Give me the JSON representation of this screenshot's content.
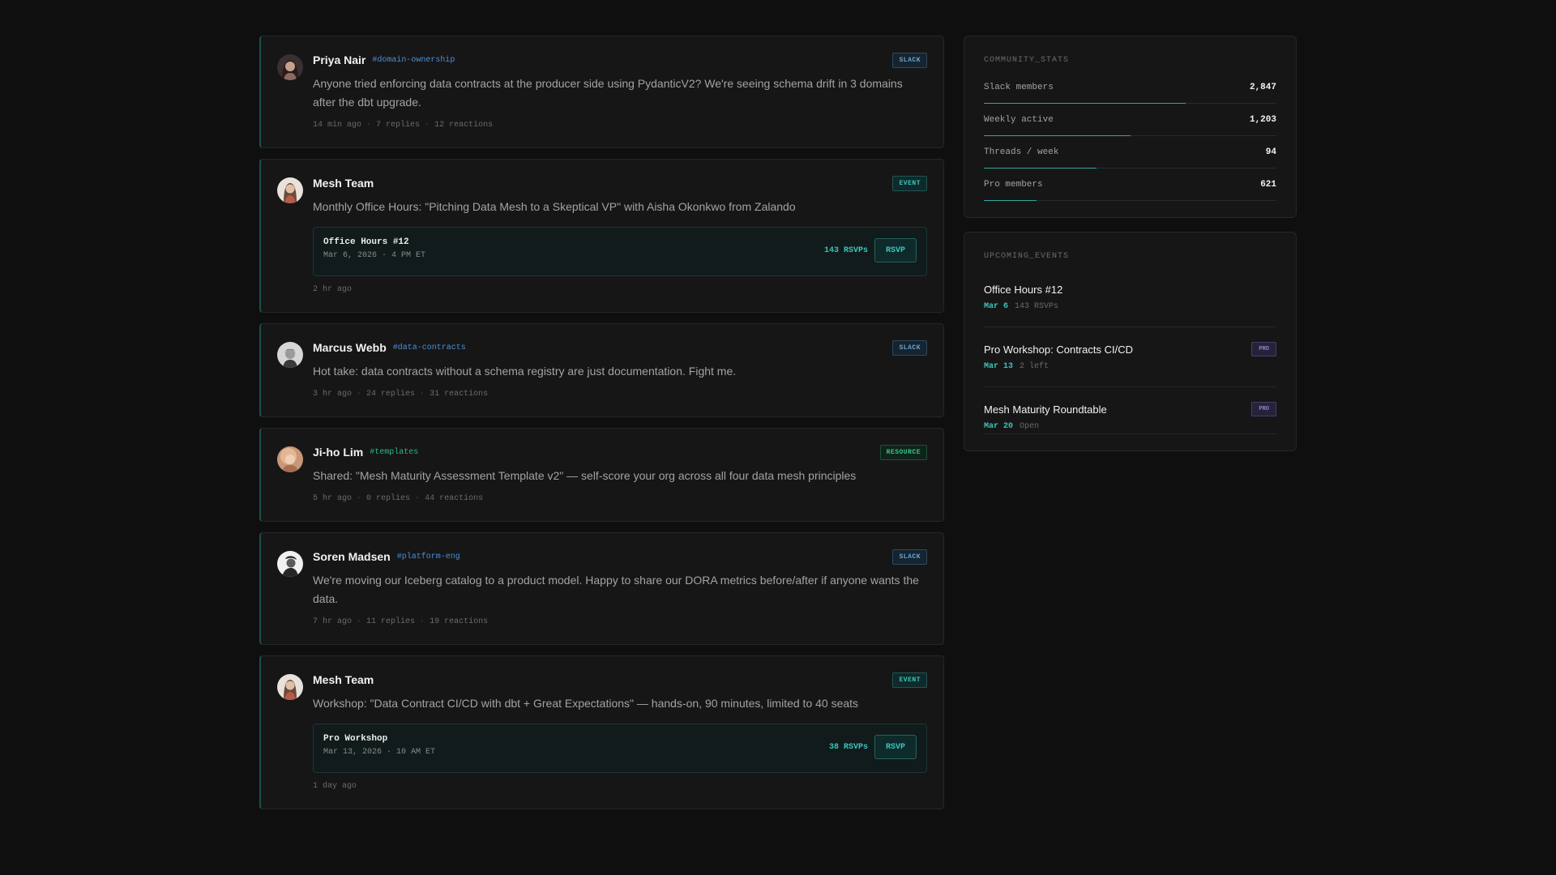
{
  "feed": {
    "posts": [
      {
        "author": "Priya Nair",
        "channel": "#domain-ownership",
        "tag": "SLACK",
        "body": "Anyone tried enforcing data contracts at the producer side using PydanticV2? We're seeing schema drift in 3 domains after the dbt upgrade.",
        "time": "14 min ago",
        "replies": "7 replies",
        "reactions": "12 reactions"
      },
      {
        "author": "Mesh Team",
        "tag": "EVENT",
        "body": "Monthly Office Hours: \"Pitching Data Mesh to a Skeptical VP\" with Aisha Okonkwo from Zalando",
        "event": {
          "title": "Office Hours #12",
          "date": "Mar 6, 2026 · 4 PM ET",
          "rsvps": "143 RSVPs",
          "button": "RSVP"
        },
        "time": "2 hr ago"
      },
      {
        "author": "Marcus Webb",
        "channel": "#data-contracts",
        "tag": "SLACK",
        "body": "Hot take: data contracts without a schema registry are just documentation. Fight me.",
        "time": "3 hr ago",
        "replies": "24 replies",
        "reactions": "31 reactions"
      },
      {
        "author": "Ji-ho Lim",
        "channel": "#templates",
        "tag": "RESOURCE",
        "body": "Shared: \"Mesh Maturity Assessment Template v2\" — self-score your org across all four data mesh principles",
        "time": "5 hr ago",
        "replies": "0 replies",
        "reactions": "44 reactions"
      },
      {
        "author": "Soren Madsen",
        "channel": "#platform-eng",
        "tag": "SLACK",
        "body": "We're moving our Iceberg catalog to a product model. Happy to share our DORA metrics before/after if anyone wants the data.",
        "time": "7 hr ago",
        "replies": "11 replies",
        "reactions": "19 reactions"
      },
      {
        "author": "Mesh Team",
        "tag": "EVENT",
        "body": "Workshop: \"Data Contract CI/CD with dbt + Great Expectations\" — hands-on, 90 minutes, limited to 40 seats",
        "event": {
          "title": "Pro Workshop",
          "date": "Mar 13, 2026 · 10 AM ET",
          "rsvps": "38 RSVPs",
          "button": "RSVP"
        },
        "time": "1 day ago"
      }
    ]
  },
  "community_stats": {
    "title": "COMMUNITY_STATS",
    "stats": [
      {
        "label": "Slack members",
        "value": "2,847",
        "fill": 0.69
      },
      {
        "label": "Weekly active",
        "value": "1,203",
        "fill": 0.5
      },
      {
        "label": "Threads / week",
        "value": "94",
        "fill": 0.385
      },
      {
        "label": "Pro members",
        "value": "621",
        "fill": 0.18
      }
    ]
  },
  "upcoming_events": {
    "title": "UPCOMING_EVENTS",
    "events": [
      {
        "name": "Office Hours #12",
        "date": "Mar 6",
        "extra": "143 RSVPs",
        "badge": ""
      },
      {
        "name": "Pro Workshop: Contracts CI/CD",
        "date": "Mar 13",
        "extra": "2 left",
        "badge": "PRO"
      },
      {
        "name": "Mesh Maturity Roundtable",
        "date": "Mar 20",
        "extra": "Open",
        "badge": "PRO"
      }
    ]
  },
  "colors": {
    "accent": "#38c6bd",
    "slack_tag": "#6aa5cf",
    "channel": "#4a90d9",
    "resource": "#2fb58a",
    "pro": "#8e86c7"
  }
}
